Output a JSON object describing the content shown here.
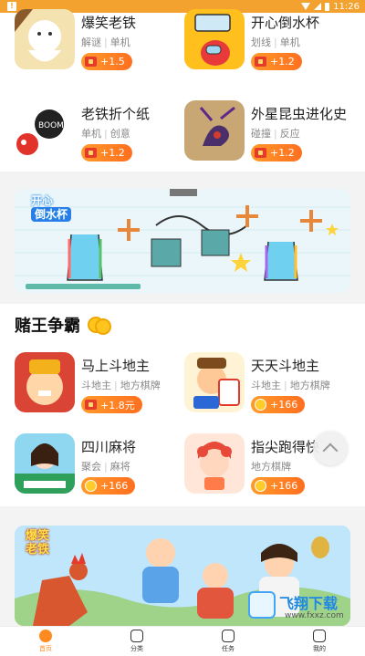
{
  "status": {
    "time": "11:26"
  },
  "games_top": [
    {
      "title": "爆笑老铁",
      "tags": [
        "解谜",
        "单机"
      ],
      "reward": "+1.5"
    },
    {
      "title": "开心倒水杯",
      "tags": [
        "划线",
        "单机"
      ],
      "reward": "+1.2"
    },
    {
      "title": "老铁折个纸",
      "tags": [
        "单机",
        "创意"
      ],
      "reward": "+1.2"
    },
    {
      "title": "外星昆虫进化史",
      "tags": [
        "碰撞",
        "反应"
      ],
      "reward": "+1.2"
    }
  ],
  "banner1": {
    "logo_line1": "开心",
    "logo_line2": "倒水杯"
  },
  "section": {
    "title": "赌王争霸"
  },
  "games_bottom": [
    {
      "title": "马上斗地主",
      "tags": [
        "斗地主",
        "地方棋牌"
      ],
      "reward": "+1.8元",
      "reward_type": "redpacket"
    },
    {
      "title": "天天斗地主",
      "tags": [
        "斗地主",
        "地方棋牌"
      ],
      "reward": "+166",
      "reward_type": "coin"
    },
    {
      "title": "四川麻将",
      "tags": [
        "聚会",
        "麻将"
      ],
      "reward": "+166",
      "reward_type": "coin"
    },
    {
      "title": "指尖跑得快",
      "tags": [
        "地方棋牌"
      ],
      "reward": "+166",
      "reward_type": "coin"
    }
  ],
  "banner2": {
    "logo_line1": "爆笑",
    "logo_line2": "老铁"
  },
  "tabs": [
    {
      "label": "首页",
      "icon": "home-icon",
      "active": true
    },
    {
      "label": "分类",
      "icon": "category-icon",
      "active": false
    },
    {
      "label": "任务",
      "icon": "task-icon",
      "active": false
    },
    {
      "label": "我的",
      "icon": "profile-icon",
      "active": false
    }
  ],
  "watermark": {
    "text": "飞翔下载",
    "url": "www.fxxz.com"
  },
  "colors": {
    "accent": "#ff8a1f",
    "statusbar": "#f3a12f"
  }
}
